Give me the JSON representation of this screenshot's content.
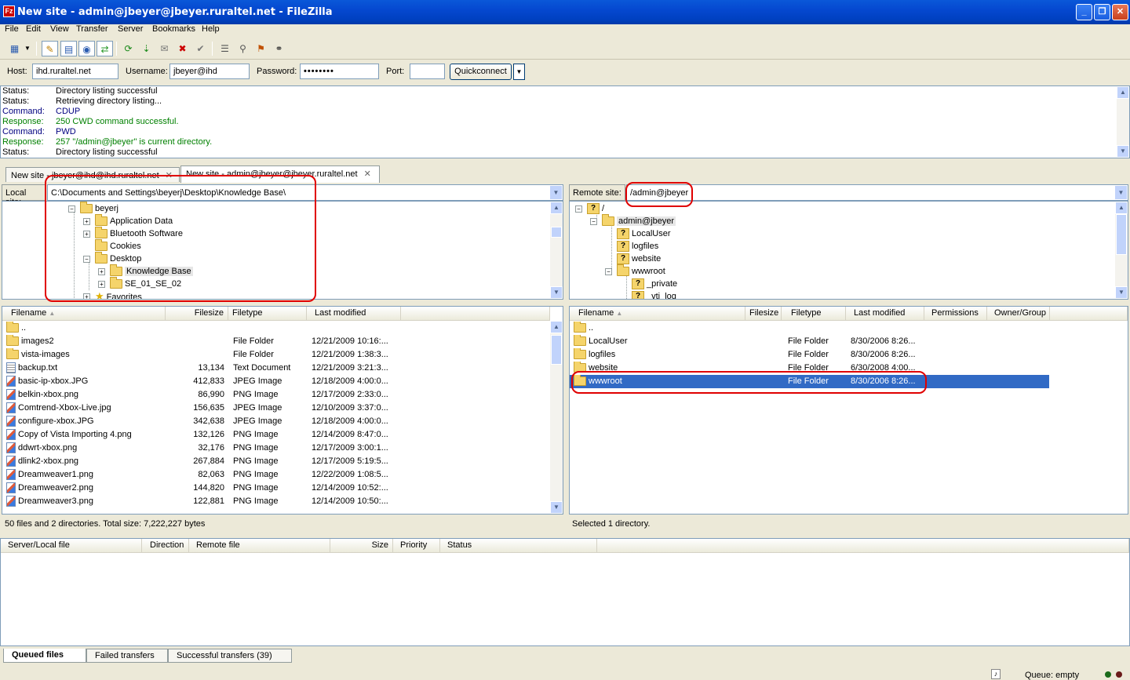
{
  "window": {
    "title": "New site - admin@jbeyer@jbeyer.ruraltel.net - FileZilla",
    "app_icon": "Fz",
    "min": "_",
    "max": "❐",
    "close": "✕"
  },
  "menu": [
    "File",
    "Edit",
    "View",
    "Transfer",
    "Server",
    "Bookmarks",
    "Help"
  ],
  "quickconnect": {
    "host_label": "Host:",
    "host": "ihd.ruraltel.net",
    "user_label": "Username:",
    "user": "jbeyer@ihd",
    "pass_label": "Password:",
    "pass": "••••••••",
    "port_label": "Port:",
    "port": "",
    "button": "Quickconnect"
  },
  "log": [
    {
      "type": "Status:",
      "msg": "Directory listing successful",
      "kind": "status"
    },
    {
      "type": "Status:",
      "msg": "Retrieving directory listing...",
      "kind": "status"
    },
    {
      "type": "Command:",
      "msg": "CDUP",
      "kind": "cmd"
    },
    {
      "type": "Response:",
      "msg": "250 CWD command successful.",
      "kind": "resp"
    },
    {
      "type": "Command:",
      "msg": "PWD",
      "kind": "cmd"
    },
    {
      "type": "Response:",
      "msg": "257 \"/admin@jbeyer\" is current directory.",
      "kind": "resp"
    },
    {
      "type": "Status:",
      "msg": "Directory listing successful",
      "kind": "status"
    }
  ],
  "tabs": [
    {
      "label": "New site - jbeyer@ihd@ihd.ruraltel.net"
    },
    {
      "label": "New site - admin@jbeyer@jbeyer.ruraltel.net"
    }
  ],
  "local": {
    "site_label": "Local site:",
    "path": "C:\\Documents and Settings\\beyerj\\Desktop\\Knowledge Base\\",
    "tree": [
      "beyerj",
      "Application Data",
      "Bluetooth Software",
      "Cookies",
      "Desktop",
      "Knowledge Base",
      "SE_01_SE_02",
      "Favorites"
    ],
    "columns": [
      "Filename",
      "Filesize",
      "Filetype",
      "Last modified"
    ],
    "files": [
      {
        "name": "..",
        "size": "",
        "type": "",
        "mod": "",
        "icon": "folder"
      },
      {
        "name": "images2",
        "size": "",
        "type": "File Folder",
        "mod": "12/21/2009 10:16:...",
        "icon": "folder"
      },
      {
        "name": "vista-images",
        "size": "",
        "type": "File Folder",
        "mod": "12/21/2009 1:38:3...",
        "icon": "folder"
      },
      {
        "name": "backup.txt",
        "size": "13,134",
        "type": "Text Document",
        "mod": "12/21/2009 3:21:3...",
        "icon": "txt"
      },
      {
        "name": "basic-ip-xbox.JPG",
        "size": "412,833",
        "type": "JPEG Image",
        "mod": "12/18/2009 4:00:0...",
        "icon": "img"
      },
      {
        "name": "belkin-xbox.png",
        "size": "86,990",
        "type": "PNG Image",
        "mod": "12/17/2009 2:33:0...",
        "icon": "img"
      },
      {
        "name": "Comtrend-Xbox-Live.jpg",
        "size": "156,635",
        "type": "JPEG Image",
        "mod": "12/10/2009 3:37:0...",
        "icon": "img"
      },
      {
        "name": "configure-xbox.JPG",
        "size": "342,638",
        "type": "JPEG Image",
        "mod": "12/18/2009 4:00:0...",
        "icon": "img"
      },
      {
        "name": "Copy of Vista Importing 4.png",
        "size": "132,126",
        "type": "PNG Image",
        "mod": "12/14/2009 8:47:0...",
        "icon": "img"
      },
      {
        "name": "ddwrt-xbox.png",
        "size": "32,176",
        "type": "PNG Image",
        "mod": "12/17/2009 3:00:1...",
        "icon": "img"
      },
      {
        "name": "dlink2-xbox.png",
        "size": "267,884",
        "type": "PNG Image",
        "mod": "12/17/2009 5:19:5...",
        "icon": "img"
      },
      {
        "name": "Dreamweaver1.png",
        "size": "82,063",
        "type": "PNG Image",
        "mod": "12/22/2009 1:08:5...",
        "icon": "img"
      },
      {
        "name": "Dreamweaver2.png",
        "size": "144,820",
        "type": "PNG Image",
        "mod": "12/14/2009 10:52:...",
        "icon": "img"
      },
      {
        "name": "Dreamweaver3.png",
        "size": "122,881",
        "type": "PNG Image",
        "mod": "12/14/2009 10:50:...",
        "icon": "img"
      }
    ],
    "status": "50 files and 2 directories. Total size: 7,222,227 bytes"
  },
  "remote": {
    "site_label": "Remote site:",
    "path": "/admin@jbeyer",
    "tree": [
      "/",
      "admin@jbeyer",
      "LocalUser",
      "logfiles",
      "website",
      "wwwroot",
      "_private",
      "_vti_log"
    ],
    "columns": [
      "Filename",
      "Filesize",
      "Filetype",
      "Last modified",
      "Permissions",
      "Owner/Group"
    ],
    "files": [
      {
        "name": "..",
        "type": "",
        "mod": ""
      },
      {
        "name": "LocalUser",
        "type": "File Folder",
        "mod": "8/30/2006 8:26..."
      },
      {
        "name": "logfiles",
        "type": "File Folder",
        "mod": "8/30/2006 8:26..."
      },
      {
        "name": "website",
        "type": "File Folder",
        "mod": "6/30/2008 4:00..."
      },
      {
        "name": "wwwroot",
        "type": "File Folder",
        "mod": "8/30/2006 8:26..."
      }
    ],
    "status": "Selected 1 directory."
  },
  "queue": {
    "columns": [
      "Server/Local file",
      "Direction",
      "Remote file",
      "Size",
      "Priority",
      "Status"
    ],
    "tabs": [
      "Queued files",
      "Failed transfers",
      "Successful transfers (39)"
    ],
    "status": "Queue: empty"
  },
  "colors": {
    "title_bar": "#0548d0",
    "selection": "#316ac5",
    "annotation": "#e00000"
  }
}
